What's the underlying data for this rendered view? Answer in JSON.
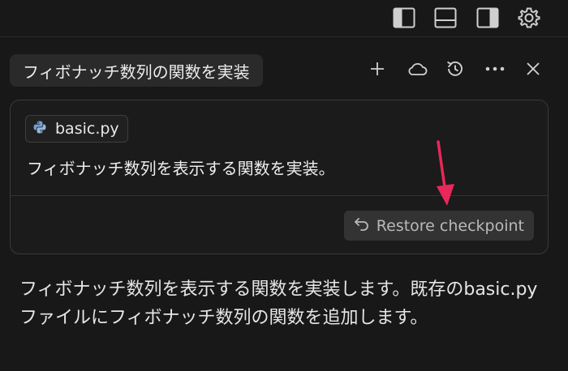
{
  "header": {
    "title": "フィボナッチ数列の関数を実装"
  },
  "message": {
    "file_chip": "basic.py",
    "text": "フィボナッチ数列を表示する関数を実装。",
    "restore_label": "Restore checkpoint"
  },
  "response": {
    "text": "フィボナッチ数列を表示する関数を実装します。既存のbasic.pyファイルにフィボナッチ数列の関数を追加します。"
  },
  "icons": {
    "topbar": [
      "toggle-left-sidebar-icon",
      "toggle-bottom-panel-icon",
      "toggle-right-sidebar-icon",
      "gear-icon"
    ],
    "header": [
      "plus-icon",
      "cloud-icon",
      "history-icon",
      "more-icon",
      "close-icon"
    ]
  },
  "colors": {
    "background": "#181818",
    "annotation_arrow": "#e8285a",
    "python_icon": "#6f9fd8"
  }
}
